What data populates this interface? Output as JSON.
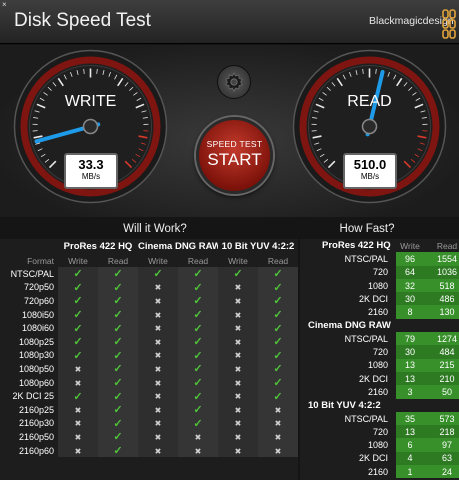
{
  "window": {
    "close_glyph": "×",
    "title": "Disk Speed Test",
    "brand": "Blackmagicdesign"
  },
  "gauges": {
    "write": {
      "label": "WRITE",
      "value": "33.3",
      "unit": "MB/s",
      "needle_fraction": 0.11
    },
    "read": {
      "label": "READ",
      "value": "510.0",
      "unit": "MB/s",
      "needle_fraction": 0.55
    }
  },
  "start_button": {
    "small": "SPEED TEST",
    "big": "START"
  },
  "will_it_work": {
    "heading": "Will it Work?",
    "groups": [
      "ProRes 422 HQ",
      "Cinema DNG RAW",
      "10 Bit YUV 4:2:2"
    ],
    "format_label": "Format",
    "write_label": "Write",
    "read_label": "Read",
    "rows": [
      {
        "format": "NTSC/PAL",
        "cells": [
          1,
          1,
          1,
          1,
          1,
          1
        ]
      },
      {
        "format": "720p50",
        "cells": [
          1,
          1,
          0,
          1,
          0,
          1
        ]
      },
      {
        "format": "720p60",
        "cells": [
          1,
          1,
          0,
          1,
          0,
          1
        ]
      },
      {
        "format": "1080i50",
        "cells": [
          1,
          1,
          0,
          1,
          0,
          1
        ]
      },
      {
        "format": "1080i60",
        "cells": [
          1,
          1,
          0,
          1,
          0,
          1
        ]
      },
      {
        "format": "1080p25",
        "cells": [
          1,
          1,
          0,
          1,
          0,
          1
        ]
      },
      {
        "format": "1080p30",
        "cells": [
          1,
          1,
          0,
          1,
          0,
          1
        ]
      },
      {
        "format": "1080p50",
        "cells": [
          0,
          1,
          0,
          1,
          0,
          1
        ]
      },
      {
        "format": "1080p60",
        "cells": [
          0,
          1,
          0,
          1,
          0,
          1
        ]
      },
      {
        "format": "2K DCI 25",
        "cells": [
          1,
          1,
          0,
          1,
          0,
          1
        ]
      },
      {
        "format": "2160p25",
        "cells": [
          0,
          1,
          0,
          1,
          0,
          0
        ]
      },
      {
        "format": "2160p30",
        "cells": [
          0,
          1,
          0,
          1,
          0,
          0
        ]
      },
      {
        "format": "2160p50",
        "cells": [
          0,
          1,
          0,
          0,
          0,
          0
        ]
      },
      {
        "format": "2160p60",
        "cells": [
          0,
          1,
          0,
          0,
          0,
          0
        ]
      }
    ]
  },
  "how_fast": {
    "heading": "How Fast?",
    "write_label": "Write",
    "read_label": "Read",
    "groups": [
      {
        "name": "ProRes 422 HQ",
        "rows": [
          {
            "format": "NTSC/PAL",
            "write": "96",
            "read": "1554"
          },
          {
            "format": "720",
            "write": "64",
            "read": "1036"
          },
          {
            "format": "1080",
            "write": "32",
            "read": "518"
          },
          {
            "format": "2K DCI",
            "write": "30",
            "read": "486"
          },
          {
            "format": "2160",
            "write": "8",
            "read": "130"
          }
        ]
      },
      {
        "name": "Cinema DNG RAW",
        "rows": [
          {
            "format": "NTSC/PAL",
            "write": "79",
            "read": "1274"
          },
          {
            "format": "720",
            "write": "30",
            "read": "484"
          },
          {
            "format": "1080",
            "write": "13",
            "read": "215"
          },
          {
            "format": "2K DCI",
            "write": "13",
            "read": "210"
          },
          {
            "format": "2160",
            "write": "3",
            "read": "50"
          }
        ]
      },
      {
        "name": "10 Bit YUV 4:2:2",
        "rows": [
          {
            "format": "NTSC/PAL",
            "write": "35",
            "read": "573"
          },
          {
            "format": "720",
            "write": "13",
            "read": "218"
          },
          {
            "format": "1080",
            "write": "6",
            "read": "97"
          },
          {
            "format": "2K DCI",
            "write": "4",
            "read": "63"
          },
          {
            "format": "2160",
            "write": "1",
            "read": "24"
          }
        ]
      }
    ]
  },
  "colors": {
    "accent": "#1e9be8",
    "check": "#50c23a",
    "fast_cell": "#2e7a23",
    "start_red": "#c43a2c",
    "gauge_red": "#9e1a12"
  }
}
